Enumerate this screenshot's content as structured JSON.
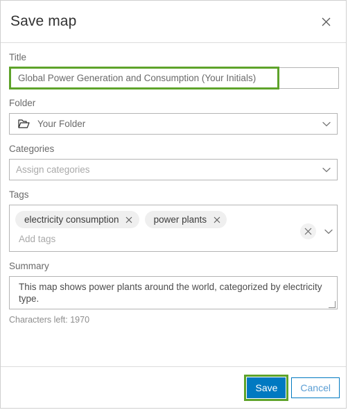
{
  "dialog": {
    "title": "Save map",
    "close_icon": "close-icon"
  },
  "form": {
    "title_field": {
      "label": "Title",
      "value": "Global Power Generation and Consumption (Your Initials)",
      "highlighted": true,
      "highlight_color": "#5ea32a"
    },
    "folder_field": {
      "label": "Folder",
      "value": "Your Folder",
      "icon": "folder-icon",
      "chevron": "chevron-down-icon"
    },
    "categories_field": {
      "label": "Categories",
      "placeholder": "Assign categories",
      "value": "",
      "chevron": "chevron-down-icon"
    },
    "tags_field": {
      "label": "Tags",
      "chips": [
        {
          "label": "electricity consumption",
          "remove_icon": "close-icon"
        },
        {
          "label": "power plants",
          "remove_icon": "close-icon"
        }
      ],
      "placeholder": "Add tags",
      "clear_icon": "close-icon",
      "chevron": "chevron-down-icon"
    },
    "summary_field": {
      "label": "Summary",
      "value": "This map shows power plants around the world, categorized by electricity type.",
      "characters_left": "Characters left: 1970"
    }
  },
  "footer": {
    "save_label": "Save",
    "cancel_label": "Cancel",
    "save_color": "#0079c1",
    "cancel_color": "#0079c1",
    "highlight_color": "#5ea32a"
  }
}
